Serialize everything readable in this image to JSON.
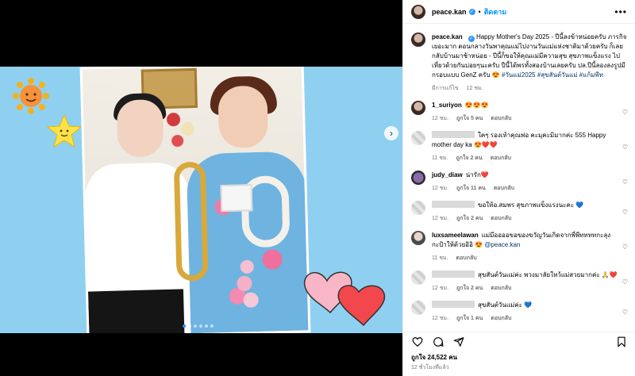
{
  "post": {
    "username": "peace.kan",
    "follow_label": "ติดตาม",
    "dot": "•",
    "more": "•••",
    "caption": "Happy Mother's Day 2025 - ปีนี้ลงข้าหน่อยครับ ภารกิจเยอะมาก ตอนกลางวันพาคุณแม่ไปงานวันแม่แห่งชาติมาด้วยครับ ก็เลยกลับบ้านมาช้าหน่อย - ปีนี้ก็ขอให้คุณแม่มีความสุข สุขภาพแข็งแรง ไปเที่ยวด้วยกันบ่อยๆนะครับ ปีนี้ได้พรทั้งสองบ้านเลยครับ ปล.ปีนี้ลองลงรูปมีกรอบแบบ GenZ ครับ",
    "caption_emoji": "😍",
    "hashtags": "#วันแม่2025 #สุขสันต์วันแม่ #แก้มพีท",
    "caption_meta": {
      "edited": "มีการแก้ไข",
      "time": "12 ชม."
    },
    "likes": "ถูกใจ 24,522 คน",
    "timestamp": "12 ชั่วโมงที่แล้ว"
  },
  "comments": [
    {
      "user": "1_suriyon",
      "text": "",
      "emoji": "😍😍😍",
      "time": "12 ชม.",
      "likes": "ถูกใจ 5 คน",
      "reply": "ตอบกลับ",
      "blurred": false
    },
    {
      "user": "",
      "text": "ใคๆ รองเท้าคุณพ่อ คะมุคะมิมากค่ะ 555 Happy mother day ka",
      "emoji": "😍❤️❤️",
      "time": "11 ชม.",
      "likes": "ถูกใจ 2 คน",
      "reply": "ตอบกลับ",
      "blurred": true
    },
    {
      "user": "judy_diaw",
      "text": "น่ารัก",
      "emoji": "❤️",
      "time": "12 ชม.",
      "likes": "ถูกใจ 11 คน",
      "reply": "ตอบกลับ",
      "blurred": false
    },
    {
      "user": "",
      "text": "ขอให้อ.สมพร สุขภาพแข็งแรงนะคะ",
      "emoji": "💙",
      "time": "12 ชม.",
      "likes": "ถูกใจ 2 คน",
      "reply": "ตอบกลับ",
      "blurred": true
    },
    {
      "user": "luxsameelawan",
      "text": "แม่มีออออขอของขวัญวันเกิดจากพี่พีททททกะลุงกะป้าให้ด้วยอิอิ",
      "emoji": "😍",
      "mention": "@peace.kan",
      "time": "11 ชม.",
      "likes": "",
      "reply": "ตอบกลับ",
      "blurred": false
    },
    {
      "user": "",
      "text": "สุขสันต์วันแม่ค่ะ พวงมาลัยใหว้แม่สวยมากค่ะ",
      "emoji": "🙏❤️",
      "time": "12 ชม.",
      "likes": "ถูกใจ 2 คน",
      "reply": "ตอบกลับ",
      "blurred": true
    },
    {
      "user": "",
      "text": "สุขสันต์วันแม่ค่ะ",
      "emoji": "💙",
      "time": "12 ชม.",
      "likes": "ถูกใจ 1 คน",
      "reply": "ตอบกลับ",
      "blurred": true
    }
  ],
  "icons": {
    "heart": "heart-icon",
    "comment": "comment-icon",
    "share": "share-icon",
    "save": "bookmark-icon",
    "next": "chevron-right-icon"
  },
  "colors": {
    "accent": "#0095f6",
    "verified": "#3897f0",
    "media_bg": "#8fd0f0"
  },
  "carousel": {
    "count": 6,
    "active_index": 0
  }
}
